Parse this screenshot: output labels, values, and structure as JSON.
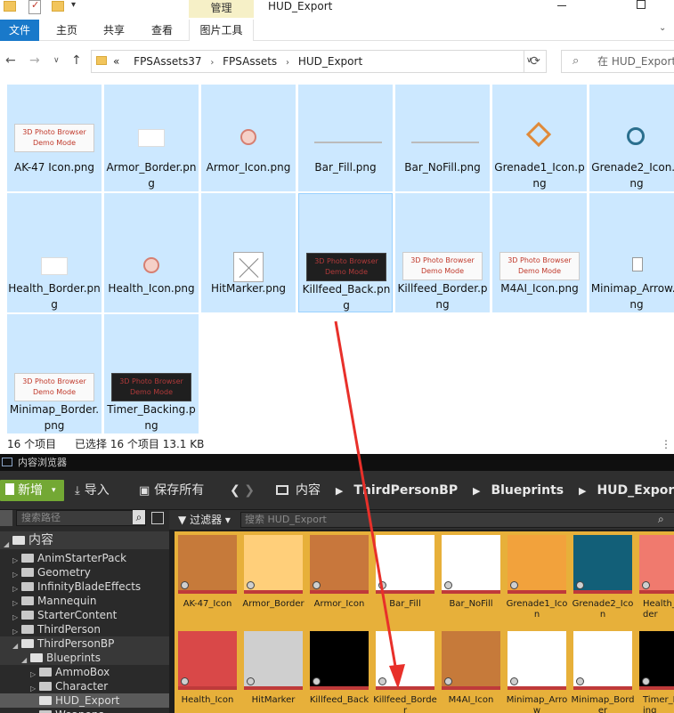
{
  "explorer": {
    "window_title": "HUD_Export",
    "manage_tab": "管理",
    "ribbon_tabs": [
      "文件",
      "主页",
      "共享",
      "查看",
      "图片工具"
    ],
    "address": {
      "overflow": "«",
      "crumbs": [
        "FPSAssets37",
        "FPSAssets",
        "HUD_Export"
      ]
    },
    "search_placeholder": "在 HUD_Export",
    "watermark": "3D Photo Browser",
    "watermark_sub": "Demo Mode",
    "files": [
      {
        "name": "AK-47 Icon.png"
      },
      {
        "name": "Armor_Border.png"
      },
      {
        "name": "Armor_Icon.png"
      },
      {
        "name": "Bar_Fill.png"
      },
      {
        "name": "Bar_NoFill.png"
      },
      {
        "name": "Grenade1_Icon.png"
      },
      {
        "name": "Grenade2_Icon.png"
      },
      {
        "name": "Health_Border.png"
      },
      {
        "name": "Health_Icon.png"
      },
      {
        "name": "HitMarker.png"
      },
      {
        "name": "Killfeed_Back.png"
      },
      {
        "name": "Killfeed_Border.png"
      },
      {
        "name": "M4AI_Icon.png"
      },
      {
        "name": "Minimap_Arrow.png"
      },
      {
        "name": "Minimap_Border.png"
      },
      {
        "name": "Timer_Backing.png"
      }
    ],
    "status": {
      "count": "16 个项目",
      "selected": "已选择 16 个项目  13.1 KB"
    }
  },
  "unreal": {
    "tab_title": "内容浏览器",
    "toolbar": {
      "add_label": "新增",
      "import_label": "导入",
      "save_label": "保存所有"
    },
    "path": [
      "内容",
      "ThirdPersonBP",
      "Blueprints",
      "HUD_Export"
    ],
    "tree_search_placeholder": "搜索路径",
    "tree": [
      {
        "label": "内容"
      },
      {
        "label": "AnimStarterPack"
      },
      {
        "label": "Geometry"
      },
      {
        "label": "InfinityBladeEffects"
      },
      {
        "label": "Mannequin"
      },
      {
        "label": "StarterContent"
      },
      {
        "label": "ThirdPerson"
      },
      {
        "label": "ThirdPersonBP"
      },
      {
        "label": "Blueprints"
      },
      {
        "label": "AmmoBox"
      },
      {
        "label": "Character"
      },
      {
        "label": "HUD_Export"
      },
      {
        "label": "Weapons"
      }
    ],
    "filter_label": "过滤器",
    "asset_search_placeholder": "搜索 HUD_Export",
    "assets": [
      {
        "name": "AK-47_Icon",
        "color": "#c67a3a"
      },
      {
        "name": "Armor_Border",
        "color": "#ffcf7a"
      },
      {
        "name": "Armor_Icon",
        "color": "#c8773c"
      },
      {
        "name": "Bar_Fill",
        "color": "#ffffff"
      },
      {
        "name": "Bar_NoFill",
        "color": "#ffffff"
      },
      {
        "name": "Grenade1_Icon",
        "color": "#f2a23c"
      },
      {
        "name": "Grenade2_Icon",
        "color": "#125f78"
      },
      {
        "name": "Health_Border",
        "color": "#f07a6e"
      },
      {
        "name": "Health_Icon",
        "color": "#d94848"
      },
      {
        "name": "HitMarker",
        "color": "#cfcfcf"
      },
      {
        "name": "Killfeed_Back",
        "color": "#000000"
      },
      {
        "name": "Killfeed_Border",
        "color": "#ffffff"
      },
      {
        "name": "M4AI_Icon",
        "color": "#c67a3a"
      },
      {
        "name": "Minimap_Arrow",
        "color": "#ffffff"
      },
      {
        "name": "Minimap_Border",
        "color": "#ffffff"
      },
      {
        "name": "Timer_Backing",
        "color": "#000000"
      }
    ]
  }
}
